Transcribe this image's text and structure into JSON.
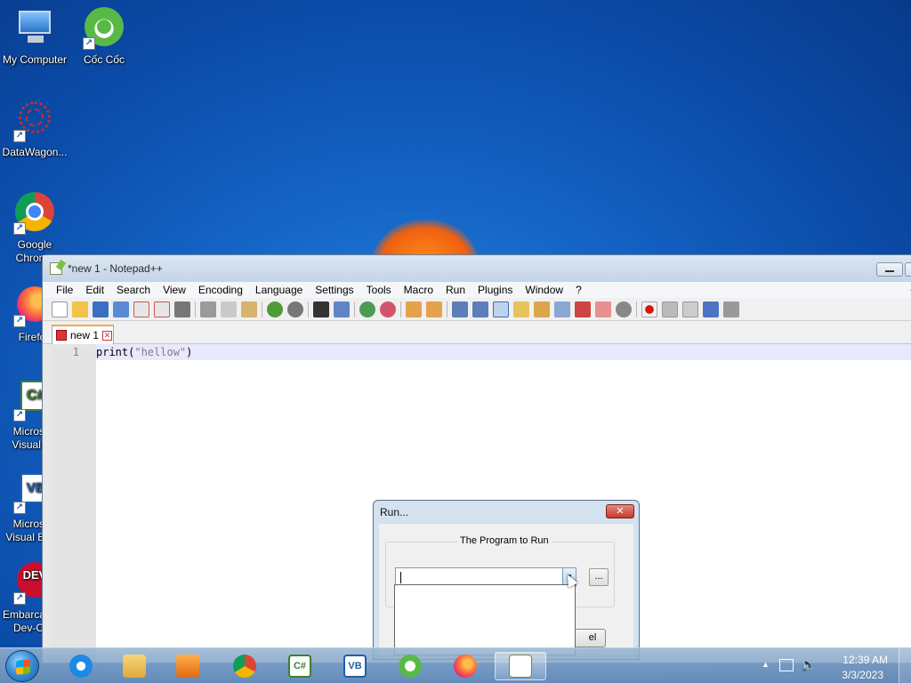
{
  "desktop": {
    "icons": [
      {
        "label": "My Computer",
        "icon": "computer-icon"
      },
      {
        "label": "Cốc Cốc",
        "icon": "coccoc-icon"
      },
      {
        "label": "DataWagon...",
        "icon": "datawagon-icon"
      },
      {
        "label": "Google Chrome",
        "icon": "chrome-icon"
      },
      {
        "label": "Firefox",
        "icon": "firefox-icon"
      },
      {
        "label": "Microsoft Visual C#",
        "icon": "csharp-icon"
      },
      {
        "label": "Microsoft Visual Basic",
        "icon": "vb-icon"
      },
      {
        "label": "Embarcadero Dev-C++",
        "icon": "devcpp-icon"
      }
    ]
  },
  "notepad": {
    "title": "*new 1 - Notepad++",
    "menu": [
      "File",
      "Edit",
      "Search",
      "View",
      "Encoding",
      "Language",
      "Settings",
      "Tools",
      "Macro",
      "Run",
      "Plugins",
      "Window",
      "?"
    ],
    "menu_extra": "+",
    "tab_label": "new 1",
    "line_number": "1",
    "code_fn": "print(",
    "code_str": "\"hellow\"",
    "code_end": ")"
  },
  "run_dialog": {
    "title": "Run...",
    "close_label": "✕",
    "group_label": "The Program to Run",
    "input_value": "",
    "browse_label": "...",
    "cancel_label_visible": "el"
  },
  "taskbar": {
    "time": "12:39 AM",
    "date": "3/3/2023",
    "apps": [
      "internet-explorer-icon",
      "file-explorer-icon",
      "media-player-icon",
      "chrome-icon",
      "csharp-icon",
      "vb-icon",
      "coccoc-icon",
      "firefox-icon",
      "notepadpp-icon"
    ]
  },
  "colors": {
    "desktop_bg": "#1566c8",
    "tab_accent": "#f9a54a",
    "current_line": "#e8e8ff",
    "close_red": "#c4392b"
  }
}
